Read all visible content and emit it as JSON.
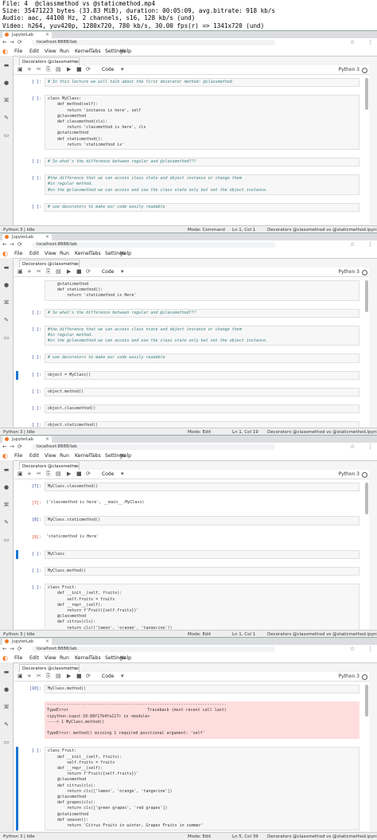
{
  "header": {
    "lines": [
      "File: 4  @classmethod vs @staticmethod.mp4",
      "Size: 35471223 bytes (33.83 MiB), duration: 00:05:09, avg.bitrate: 918 kb/s",
      "Audio: aac, 44100 Hz, 2 channels, s16, 128 kb/s (und)",
      "Video: h264, yuv420p, 1280x720, 780 kb/s, 30.00 fps(r) => 1341x720 (und)"
    ]
  },
  "browser": {
    "tab_title": "JupyterLab",
    "url": "localhost:8888/lab"
  },
  "menu": [
    "File",
    "Edit",
    "View",
    "Run",
    "Kernel",
    "Tabs",
    "Settings",
    "Help"
  ],
  "notebook": {
    "tab_title": "Decorators @classmethod v",
    "cell_type": "Code",
    "kernel": "Python 3"
  },
  "frames": [
    {
      "cells": [
        {
          "prompt": "[ ]:",
          "code": "# In this lecture we will talk about the first decorator method: @classmethod",
          "comment": true,
          "lines": 1
        },
        {
          "prompt": "[ ]:",
          "code": "class MyClass:\n    def method(self):\n        return 'instance is here', self\n    @classmethod\n    def classmethod(cls):\n        return 'classmethod is here', cls\n    @staticmethod\n    def staticmethod():\n        return 'staticmethod is'",
          "lines": 9
        },
        {
          "prompt": "[ ]:",
          "code": "# So what's the difference between regular and @classmethod???",
          "comment": true,
          "lines": 1
        },
        {
          "prompt": "[ ]:",
          "code": "#the difference that we can access class state and object instance or change them\n#in regular method.\n#in the @classmethod we can access and use the class state only but not the object instance.",
          "comment": true,
          "lines": 3
        },
        {
          "prompt": "[ ]:",
          "code": "# use decorators to make our code easily readable",
          "comment": true,
          "lines": 1
        }
      ],
      "status": {
        "left": "Python 3 | Idle",
        "mode": "Mode: Command",
        "pos": "Ln 1, Col 1",
        "file": "Decorators @classmethod vs @staticmethod.ipynb"
      }
    },
    {
      "cells": [
        {
          "prompt": "",
          "code": "    @staticmethod\n    def staticmethod():\n        return 'staticmethod is Here'",
          "lines": 3
        },
        {
          "prompt": "[ ]:",
          "code": "# So what's the difference between regular and @classmethod???",
          "comment": true,
          "lines": 1
        },
        {
          "prompt": "[ ]:",
          "code": "#the difference that we can access class state and object instance or change them\n#in regular method.\n#in the @classmethod we can access and use the class state only but not the object instance.",
          "comment": true,
          "lines": 3
        },
        {
          "prompt": "[ ]:",
          "code": "# use decorators to make our code easily readable",
          "comment": true,
          "lines": 1
        },
        {
          "prompt": "[ ]:",
          "code": "object = MyClass()",
          "lines": 1,
          "active": true
        },
        {
          "prompt": "[ ]:",
          "code": "object.method()",
          "lines": 1
        },
        {
          "prompt": "[ ]:",
          "code": "object.classmethod()",
          "lines": 1
        },
        {
          "prompt": "[ ]:",
          "code": "object.staticmethod()",
          "lines": 1
        }
      ],
      "status": {
        "left": "Python 3 | Idle",
        "mode": "Mode: Edit",
        "pos": "Ln 1, Col 19",
        "file": "Decorators @classmethod vs @staticmethod.ipynb"
      }
    },
    {
      "cells": [
        {
          "prompt": "[7]:",
          "code": "MyClass.classmethod()",
          "lines": 1
        },
        {
          "prompt": "[7]:",
          "output": "('classmethod is here', __main__.MyClass)",
          "lines": 1
        },
        {
          "prompt": "[8]:",
          "code": "MyClass.staticmethod()",
          "lines": 1
        },
        {
          "prompt": "[8]:",
          "output": "'staticmethod is Here'",
          "lines": 1
        },
        {
          "prompt": "[ ]:",
          "code": "MyClass",
          "lines": 1,
          "active": true
        },
        {
          "prompt": "[ ]:",
          "code": "MyClass.method()",
          "lines": 1
        },
        {
          "prompt": "[ ]:",
          "code": "class Fruit:\n    def __init__(self, fruits):\n        self.fruits = fruits\n    def __repr__(self):\n        return f'Fruit({self.fruits})'\n    @classmethod\n    def citrus(cls):\n        return cls(['lemon', 'orange', 'tangerine'])\n    @classmethod",
          "lines": 9
        }
      ],
      "status": {
        "left": "Python 3 | Idle",
        "mode": "Mode: Edit",
        "pos": "Ln 1, Col 1",
        "file": "Decorators @classmethod vs @staticmethod.ipynb"
      }
    },
    {
      "cells": [
        {
          "prompt": "[10]:",
          "code": "MyClass.method()",
          "lines": 1
        },
        {
          "prompt": "",
          "error": "---------------------------------------------------------------------------\nTypeError                                 Traceback (most recent call last)\n<ipython-input-10-88f17b4fa117> in <module>\n----> 1 MyClass.method()\n\nTypeError: method() missing 1 required positional argument: 'self'",
          "lines": 6
        },
        {
          "prompt": "[ ]:",
          "code": "class Fruit:\n    def __init__(self, fruits):\n        self.fruits = fruits\n    def __repr__(self):\n        return f'Fruit({self.fruits})'\n    @classmethod\n    def citrus(cls):\n        return cls(['lemon', 'orange', 'tangerine'])\n    @classmethod\n    def grapes(cls):\n        return cls(['green grapes', 'red grapes'])\n    @staticmethod\n    def season():\n        return 'Citrus Fruits in winter, Grapes Fruits in summer'",
          "lines": 14,
          "active": true
        }
      ],
      "status": {
        "left": "Python 3 | Idle",
        "mode": "Mode: Edit",
        "pos": "Ln 5, Col 39",
        "file": "Decorators @classmethod vs @staticmethod.ipynb"
      }
    }
  ]
}
